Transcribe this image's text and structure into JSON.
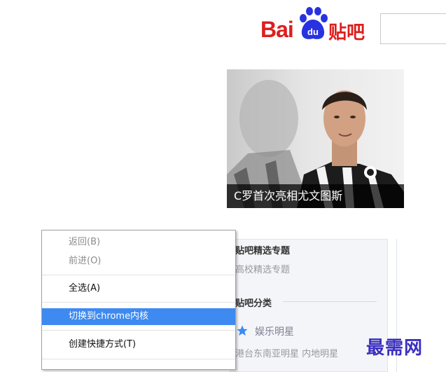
{
  "logo": {
    "latin": "Bai",
    "du": "du",
    "chinese": "贴吧"
  },
  "banner": {
    "caption": "C罗首次亮相尤文图斯"
  },
  "panel": {
    "heading1": "贴吧精选专题",
    "sub1": "高校精选专题",
    "heading2": "贴吧分类",
    "category_entertainment": "娱乐明星",
    "sub_links": "港台东南亚明星  内地明星"
  },
  "context_menu": {
    "items": [
      {
        "label": "返回(B)",
        "enabled": false
      },
      {
        "label": "前进(O)",
        "enabled": false
      },
      {
        "label": "全选(A)",
        "enabled": true
      },
      {
        "label": "切换到chrome内核",
        "enabled": true,
        "highlighted": true
      },
      {
        "label": "创建快捷方式(T)",
        "enabled": true
      }
    ]
  },
  "watermark": "最需网",
  "colors": {
    "brand_red": "#de1e1e",
    "brand_blue": "#2932e1",
    "highlight": "#3e8af0",
    "watermark": "#3b2fbf"
  }
}
